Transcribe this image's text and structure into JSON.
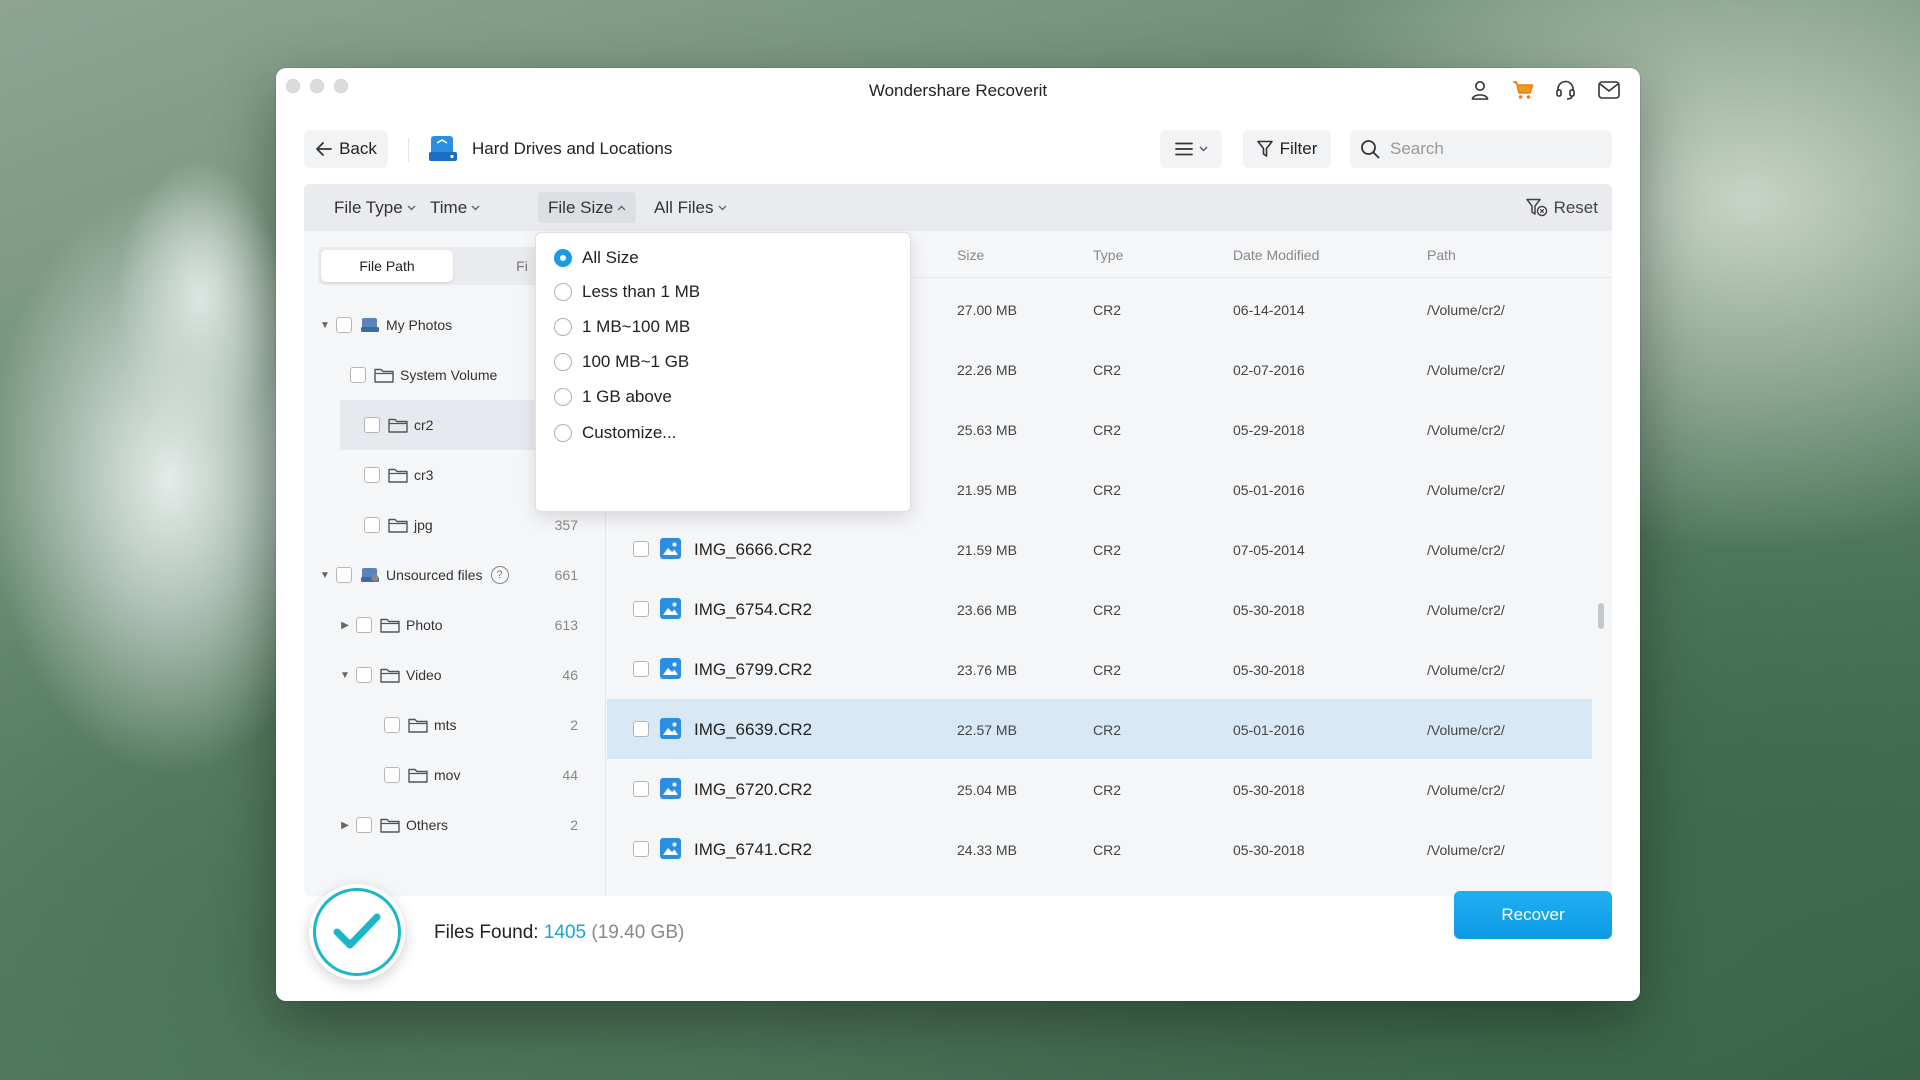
{
  "window": {
    "title": "Wondershare Recoverit"
  },
  "toolbar": {
    "back_label": "Back",
    "location_label": "Hard Drives and Locations",
    "filter_label": "Filter",
    "search_placeholder": "Search"
  },
  "filterbar": {
    "file_type": "File Type",
    "time": "Time",
    "file_size": "File Size",
    "all_files": "All Files",
    "reset": "Reset"
  },
  "tabs": {
    "file_path": "File Path",
    "second": "Fi"
  },
  "tree": [
    {
      "label": "My Photos",
      "count": ""
    },
    {
      "label": "System Volume",
      "count": ""
    },
    {
      "label": "cr2",
      "count": ""
    },
    {
      "label": "cr3",
      "count": ""
    },
    {
      "label": "jpg",
      "count": "357"
    },
    {
      "label": "Unsourced files",
      "count": "661"
    },
    {
      "label": "Photo",
      "count": "613"
    },
    {
      "label": "Video",
      "count": "46"
    },
    {
      "label": "mts",
      "count": "2"
    },
    {
      "label": "mov",
      "count": "44"
    },
    {
      "label": "Others",
      "count": "2"
    }
  ],
  "columns": {
    "size": "Size",
    "type": "Type",
    "date": "Date Modified",
    "path": "Path"
  },
  "files": [
    {
      "name": "",
      "size": "27.00 MB",
      "type": "CR2",
      "date": "06-14-2014",
      "path": "/Volume/cr2/"
    },
    {
      "name": "",
      "size": "22.26 MB",
      "type": "CR2",
      "date": "02-07-2016",
      "path": "/Volume/cr2/"
    },
    {
      "name": "",
      "size": "25.63 MB",
      "type": "CR2",
      "date": "05-29-2018",
      "path": "/Volume/cr2/"
    },
    {
      "name": "",
      "size": "21.95 MB",
      "type": "CR2",
      "date": "05-01-2016",
      "path": "/Volume/cr2/"
    },
    {
      "name": "IMG_6666.CR2",
      "size": "21.59 MB",
      "type": "CR2",
      "date": "07-05-2014",
      "path": "/Volume/cr2/"
    },
    {
      "name": "IMG_6754.CR2",
      "size": "23.66 MB",
      "type": "CR2",
      "date": "05-30-2018",
      "path": "/Volume/cr2/"
    },
    {
      "name": "IMG_6799.CR2",
      "size": "23.76 MB",
      "type": "CR2",
      "date": "05-30-2018",
      "path": "/Volume/cr2/"
    },
    {
      "name": "IMG_6639.CR2",
      "size": "22.57 MB",
      "type": "CR2",
      "date": "05-01-2016",
      "path": "/Volume/cr2/"
    },
    {
      "name": "IMG_6720.CR2",
      "size": "25.04 MB",
      "type": "CR2",
      "date": "05-30-2018",
      "path": "/Volume/cr2/"
    },
    {
      "name": "IMG_6741.CR2",
      "size": "24.33 MB",
      "type": "CR2",
      "date": "05-30-2018",
      "path": "/Volume/cr2/"
    }
  ],
  "size_dropdown": {
    "options": [
      "All Size",
      "Less than 1 MB",
      "1 MB~100 MB",
      "100 MB~1 GB",
      "1 GB above",
      "Customize..."
    ],
    "selected": "All Size"
  },
  "footer": {
    "files_found_label": "Files Found:",
    "files_found_count": "1405",
    "files_found_size": "(19.40 GB)",
    "recover_label": "Recover"
  },
  "colors": {
    "accent": "#1a9be8",
    "badge": "#1ab6c9",
    "selected_row": "#d8e9f5"
  },
  "icons": [
    "user-icon",
    "cart-icon",
    "headset-icon",
    "mail-icon",
    "back-arrow-icon",
    "drive-icon",
    "list-view-icon",
    "filter-icon",
    "search-icon",
    "reset-filter-icon",
    "folder-icon",
    "image-file-icon",
    "checkmark-icon"
  ]
}
